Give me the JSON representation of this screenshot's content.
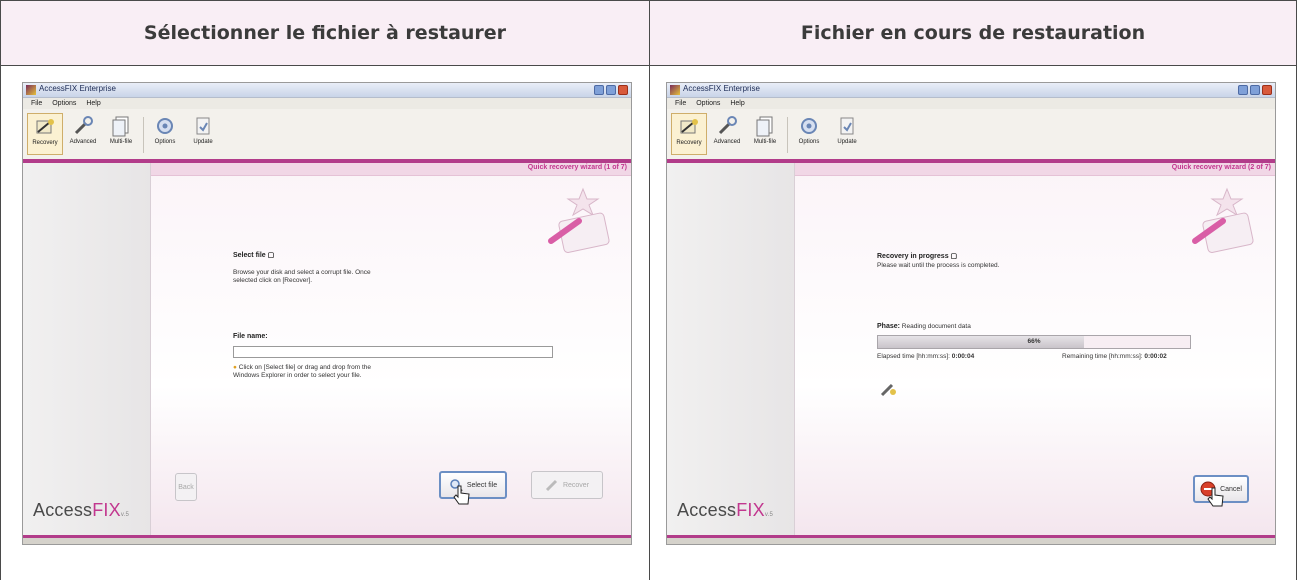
{
  "table": {
    "col1_header": "Sélectionner le fichier à restaurer",
    "col2_header": "Fichier en cours de restauration"
  },
  "app": {
    "title": "AccessFIX Enterprise",
    "menu": [
      "File",
      "Options",
      "Help"
    ],
    "toolbar": [
      "Recovery",
      "Advanced",
      "Multi-file",
      "Options",
      "Update"
    ],
    "brand_main": "Access",
    "brand_accent": "FIX",
    "brand_version": "v.5"
  },
  "left": {
    "wizard_step": "Quick recovery wizard (1 of 7)",
    "heading": "Select file",
    "desc_line1": "Browse your disk and select a corrupt file. Once",
    "desc_line2": "selected click on [Recover].",
    "file_label": "File name:",
    "file_value": "",
    "hint_line1": "Click on [Select file] or drag and drop from the",
    "hint_line2": "Windows Explorer in order to select your file.",
    "back_label": "Back",
    "select_label": "Select file",
    "recover_label": "Recover"
  },
  "right": {
    "wizard_step": "Quick recovery wizard (2 of 7)",
    "heading": "Recovery in progress",
    "sub": "Please wait until the process is completed.",
    "phase_label": "Phase:",
    "phase_value": "Reading document data",
    "progress": 0.66,
    "progress_text": "66%",
    "elapsed_label": "Elapsed time [hh:mm:ss]:",
    "elapsed_value": "0:00:04",
    "remaining_label": "Remaining time [hh:mm:ss]:",
    "remaining_value": "0:00:02",
    "cancel_label": "Cancel"
  },
  "colors": {
    "accent": "#b23c8a",
    "header_bg": "#f9eef5"
  }
}
